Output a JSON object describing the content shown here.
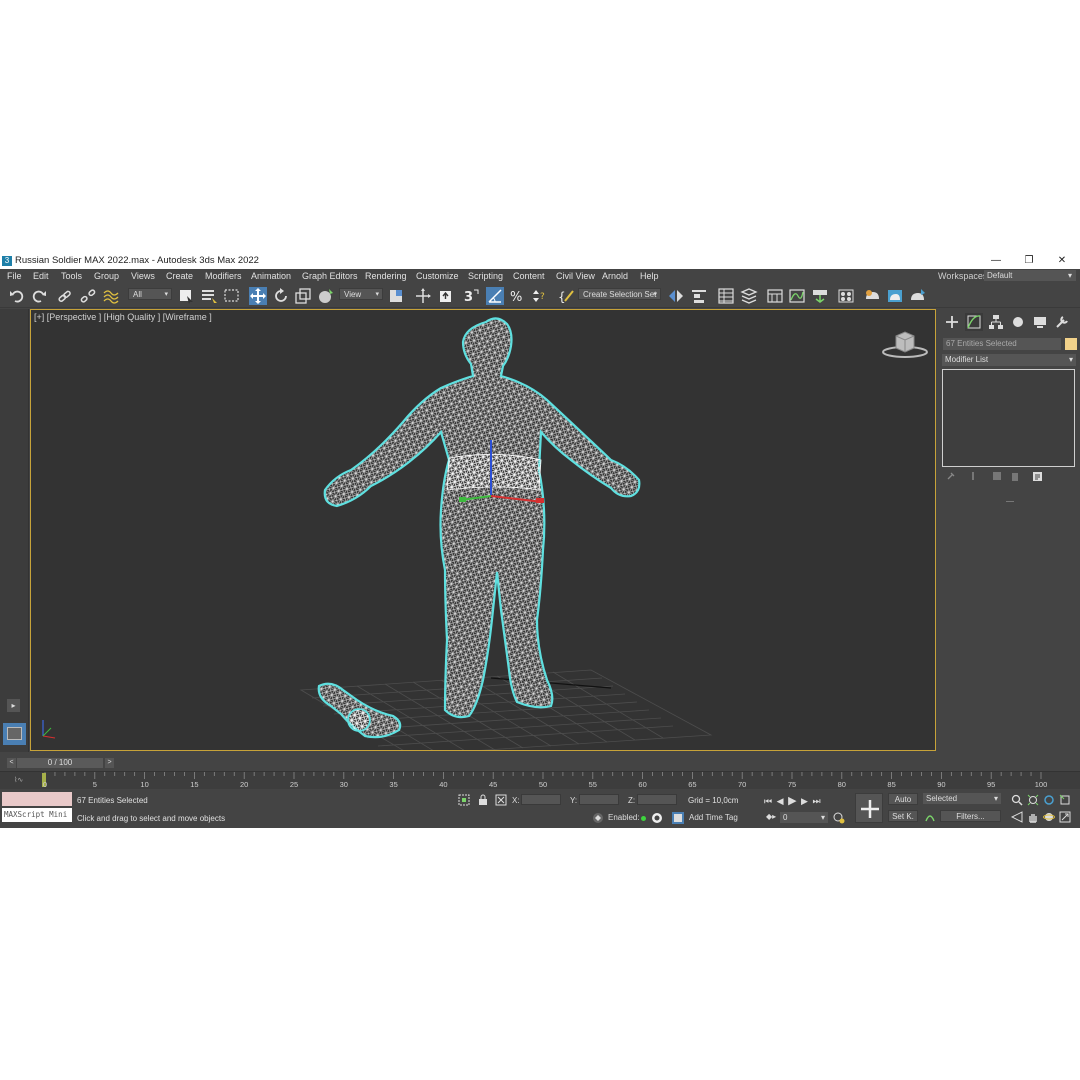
{
  "window": {
    "title": "Russian Soldier MAX 2022.max - Autodesk 3ds Max 2022",
    "app_icon_glyph": "3",
    "minimize_glyph": "—",
    "restore_glyph": "❐",
    "close_glyph": "✕"
  },
  "menu": {
    "items": [
      "File",
      "Edit",
      "Tools",
      "Group",
      "Views",
      "Create",
      "Modifiers",
      "Animation",
      "Graph Editors",
      "Rendering",
      "Customize",
      "Scripting",
      "Content",
      "Civil View",
      "Arnold",
      "Help"
    ],
    "workspaces_label": "Workspaces:",
    "workspaces_value": "Default"
  },
  "toolbar": {
    "selection_filter": "All",
    "reference_coord": "View",
    "named_selection": "Create Selection Set"
  },
  "viewport": {
    "label": "[+] [Perspective ] [High Quality ] [Wireframe ]",
    "background": "#333333",
    "border_color": "#c7a339",
    "wire_color": "#ffffff",
    "highlight_color": "#5fe0e0"
  },
  "command_panel": {
    "selection_text": "67 Entities Selected",
    "modifier_list": "Modifier List",
    "color_swatch": "#f2d28a"
  },
  "timeline": {
    "frame_display": "0 / 100",
    "prev_glyph": "<",
    "next_glyph": ">",
    "ticks": [
      "0",
      "5",
      "10",
      "15",
      "20",
      "25",
      "30",
      "35",
      "40",
      "45",
      "50",
      "55",
      "60",
      "65",
      "70",
      "75",
      "80",
      "85",
      "90",
      "95",
      "100"
    ]
  },
  "status": {
    "selected_count": "67 Entities Selected",
    "prompt": "Click and drag to select and move objects",
    "maxscript_label": "MAXScript Mini",
    "x_label": "X:",
    "y_label": "Y:",
    "z_label": "Z:",
    "grid": "Grid = 10,0cm",
    "enabled_label": "Enabled:",
    "add_time_tag": "Add Time Tag",
    "frame_value": "0",
    "auto_key": "Auto",
    "set_key": "Set K.",
    "key_filter_select": "Selected",
    "filters": "Filters..."
  }
}
